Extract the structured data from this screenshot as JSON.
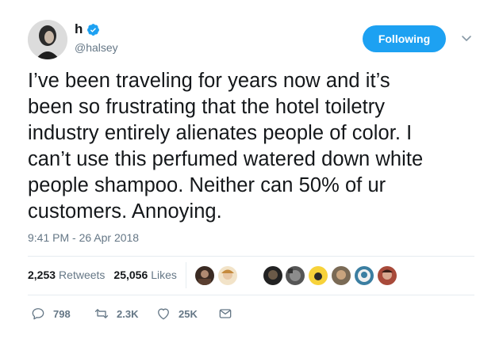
{
  "user": {
    "display_name": "h",
    "handle": "@halsey",
    "verified_icon": "verified-badge-icon"
  },
  "follow_button": {
    "label": "Following"
  },
  "tweet": {
    "lines": [
      "I’ve been traveling for years now and it’s",
      "been so frustrating that the hotel toiletry",
      "industry entirely alienates people of color. I",
      "can’t use this perfumed watered down white",
      "people shampoo. Neither can 50% of ur",
      "customers. Annoying."
    ],
    "timestamp": "9:41 PM - 26 Apr 2018"
  },
  "stats": {
    "retweets_count": "2,253",
    "retweets_label": "Retweets",
    "likes_count": "25,056",
    "likes_label": "Likes"
  },
  "actions": {
    "reply_count": "798",
    "retweet_count": "2.3K",
    "like_count": "25K"
  },
  "colors": {
    "accent": "#1da1f2",
    "muted_text": "#657786",
    "divider": "#e6ecf0"
  }
}
